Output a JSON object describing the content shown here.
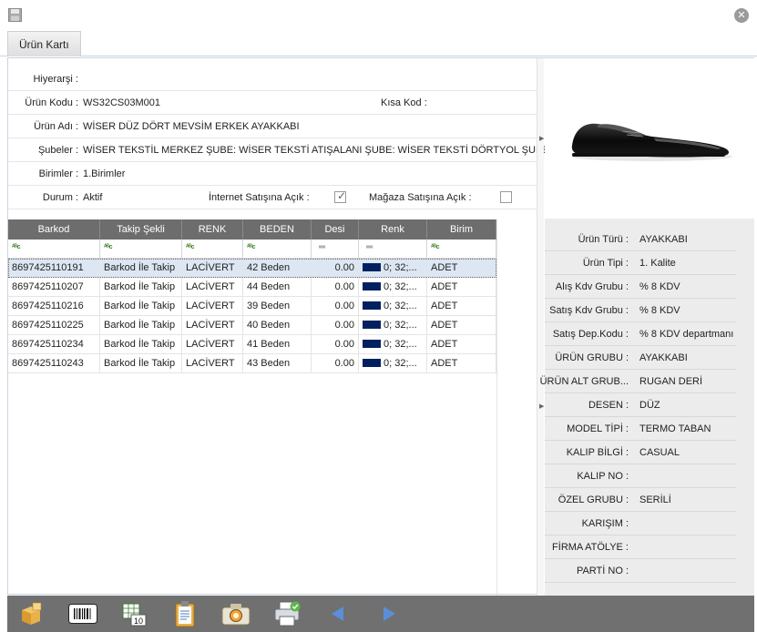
{
  "tab": {
    "label": "Ürün Kartı"
  },
  "form": {
    "hierarchy_label": "Hiyerarşi :",
    "hierarchy_value": "",
    "product_code_label": "Ürün Kodu :",
    "product_code_value": "WS32CS03M001",
    "short_code_label": "Kısa Kod :",
    "short_code_value": "",
    "product_name_label": "Ürün Adı :",
    "product_name_value": "WİSER DÜZ DÖRT MEVSİM ERKEK AYAKKABI",
    "branches_label": "Şubeler :",
    "branches_value": "WİSER TEKSTİL MERKEZ ŞUBE: WİSER TEKSTİ ATIŞALANI ŞUBE: WİSER TEKSTİ DÖRTYOL ŞUBE",
    "units_label": "Birimler :",
    "units_value": "1.Birimler",
    "status_label": "Durum :",
    "status_value": "Aktif",
    "internet_sale_label": "İnternet Satışına Açık :",
    "internet_sale_checked": true,
    "store_sale_label": "Mağaza Satışına Açık :",
    "store_sale_checked": false
  },
  "grid": {
    "columns": [
      "Barkod",
      "Takip Şekli",
      "RENK",
      "BEDEN",
      "Desi",
      "Renk",
      "Birim"
    ],
    "rows": [
      {
        "barcode": "8697425110191",
        "tracking": "Barkod İle Takip",
        "color_name": "LACİVERT",
        "size": "42 Beden",
        "desi": "0.00",
        "color_value": "0; 32;...",
        "unit": "ADET"
      },
      {
        "barcode": "8697425110207",
        "tracking": "Barkod İle Takip",
        "color_name": "LACİVERT",
        "size": "44 Beden",
        "desi": "0.00",
        "color_value": "0; 32;...",
        "unit": "ADET"
      },
      {
        "barcode": "8697425110216",
        "tracking": "Barkod İle Takip",
        "color_name": "LACİVERT",
        "size": "39 Beden",
        "desi": "0.00",
        "color_value": "0; 32;...",
        "unit": "ADET"
      },
      {
        "barcode": "8697425110225",
        "tracking": "Barkod İle Takip",
        "color_name": "LACİVERT",
        "size": "40 Beden",
        "desi": "0.00",
        "color_value": "0; 32;...",
        "unit": "ADET"
      },
      {
        "barcode": "8697425110234",
        "tracking": "Barkod İle Takip",
        "color_name": "LACİVERT",
        "size": "41 Beden",
        "desi": "0.00",
        "color_value": "0; 32;...",
        "unit": "ADET"
      },
      {
        "barcode": "8697425110243",
        "tracking": "Barkod İle Takip",
        "color_name": "LACİVERT",
        "size": "43 Beden",
        "desi": "0.00",
        "color_value": "0; 32;...",
        "unit": "ADET"
      }
    ],
    "swatch_color": "#002060",
    "filter_icon": "abc-filter-icon"
  },
  "properties": [
    {
      "label": "Ürün Türü :",
      "value": "AYAKKABI"
    },
    {
      "label": "Ürün Tipi :",
      "value": "1. Kalite"
    },
    {
      "label": "Alış Kdv Grubu :",
      "value": "% 8 KDV"
    },
    {
      "label": "Satış Kdv Grubu :",
      "value": "% 8 KDV"
    },
    {
      "label": "Satış Dep.Kodu :",
      "value": "% 8 KDV departmanı"
    },
    {
      "label": "ÜRÜN GRUBU :",
      "value": "AYAKKABI"
    },
    {
      "label": "ÜRÜN ALT GRUB...",
      "value": "RUGAN DERİ"
    },
    {
      "label": "DESEN :",
      "value": "DÜZ"
    },
    {
      "label": "MODEL TİPİ :",
      "value": "TERMO TABAN"
    },
    {
      "label": "KALIP BİLGİ :",
      "value": "CASUAL"
    },
    {
      "label": "KALIP NO :",
      "value": ""
    },
    {
      "label": "ÖZEL GRUBU :",
      "value": "SERİLİ"
    },
    {
      "label": "KARIŞIM :",
      "value": ""
    },
    {
      "label": "FİRMA ATÖLYE :",
      "value": ""
    },
    {
      "label": "PARTİ NO :",
      "value": ""
    }
  ],
  "toolbar_icons": [
    "boxes-icon",
    "barcode-icon",
    "table-10-icon",
    "clipboard-icon",
    "camera-icon",
    "printer-icon",
    "previous-icon",
    "next-icon"
  ],
  "colors": {
    "grid_header": "#6d6d6d",
    "bottom_bar": "#707070",
    "selected_row": "#dde7f3"
  }
}
